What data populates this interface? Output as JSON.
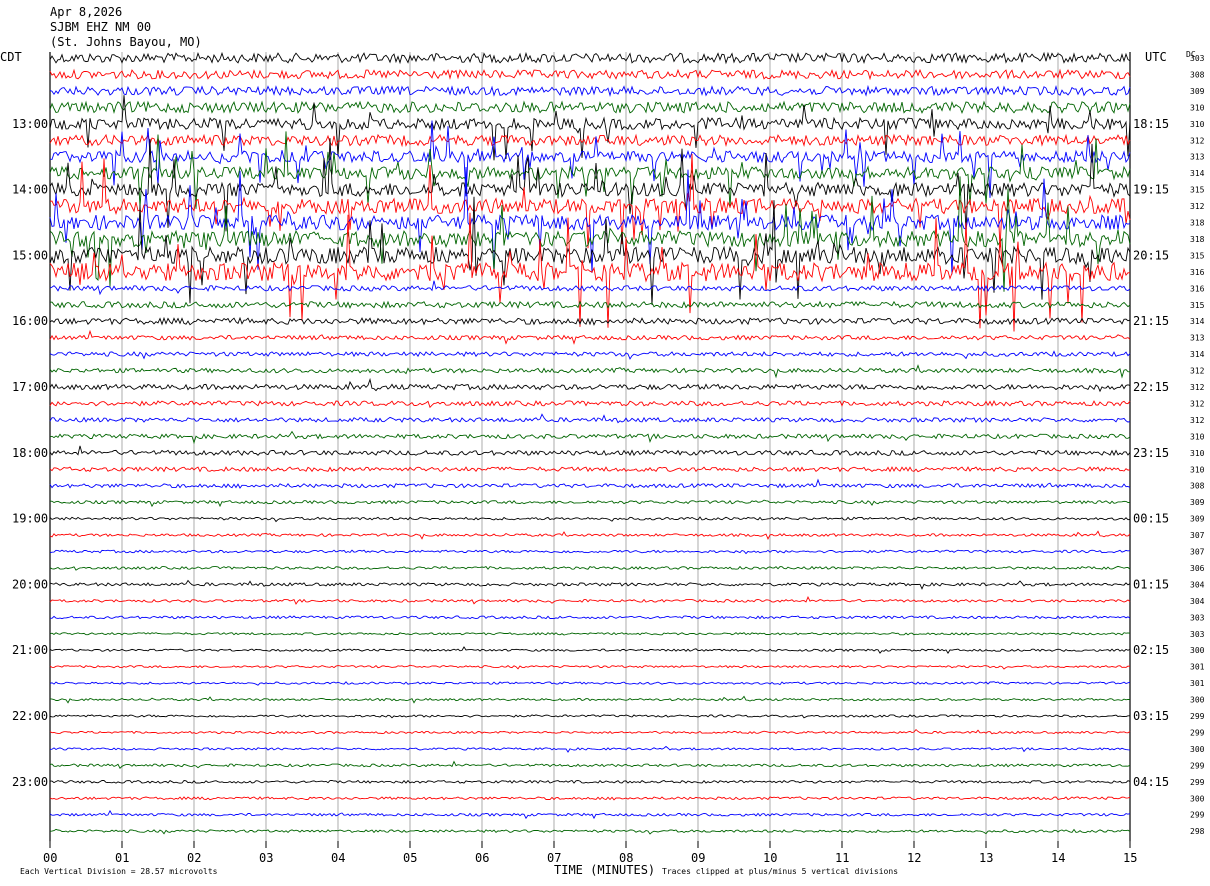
{
  "header": {
    "date": "Apr 8,2026",
    "station": "SJBM EHZ NM 00",
    "location": "(St. Johns Bayou, MO)"
  },
  "left_tz": "CDT",
  "right_tz": "UTC",
  "dc_header": "DC",
  "footer": {
    "scale": "Each Vertical Division =   28.57 microvolts",
    "xlabel": "TIME (MINUTES)",
    "clip_note": "Traces clipped at plus/minus 5 vertical divisions"
  },
  "colors": {
    "black": "#000000",
    "red": "#ff0000",
    "blue": "#0000ff",
    "green": "#006400"
  },
  "chart_data": {
    "type": "line",
    "title": "SJBM EHZ NM 00",
    "xlabel": "TIME (MINUTES)",
    "xlim": [
      0,
      15
    ],
    "x_ticks": [
      "00",
      "01",
      "02",
      "03",
      "04",
      "05",
      "06",
      "07",
      "08",
      "09",
      "10",
      "11",
      "12",
      "13",
      "14",
      "15"
    ],
    "trace_color_cycle": [
      "black",
      "red",
      "blue",
      "green"
    ],
    "left_hour_labels": [
      "13:00",
      "14:00",
      "15:00",
      "16:00",
      "17:00",
      "18:00",
      "19:00",
      "20:00",
      "21:00",
      "22:00",
      "23:00"
    ],
    "right_hour_labels": [
      "18:15",
      "19:15",
      "20:15",
      "21:15",
      "22:15",
      "23:15",
      "00:15",
      "01:15",
      "02:15",
      "03:15",
      "04:15"
    ],
    "dc_offsets": [
      303,
      308,
      309,
      310,
      310,
      312,
      313,
      314,
      315,
      312,
      318,
      318,
      315,
      316,
      316,
      315,
      314,
      313,
      314,
      312,
      312,
      312,
      312,
      310,
      310,
      310,
      308,
      309,
      309,
      307,
      307,
      306,
      304,
      304,
      303,
      303,
      300,
      301,
      301,
      300,
      299,
      299,
      300,
      299,
      299,
      300,
      299,
      298
    ],
    "trace_activity": [
      2.2,
      2.0,
      2.0,
      2.5,
      2.6,
      2.4,
      2.6,
      2.8,
      3.2,
      3.4,
      3.4,
      3.6,
      3.8,
      4.2,
      1.2,
      1.4,
      1.4,
      1.0,
      1.0,
      1.0,
      1.2,
      1.1,
      1.0,
      1.0,
      1.1,
      1.0,
      0.9,
      0.7,
      0.6,
      0.6,
      0.6,
      0.6,
      0.7,
      0.6,
      0.6,
      0.5,
      0.5,
      0.5,
      0.5,
      0.5,
      0.5,
      0.5,
      0.5,
      0.6,
      0.6,
      0.6,
      0.6,
      0.6
    ]
  }
}
